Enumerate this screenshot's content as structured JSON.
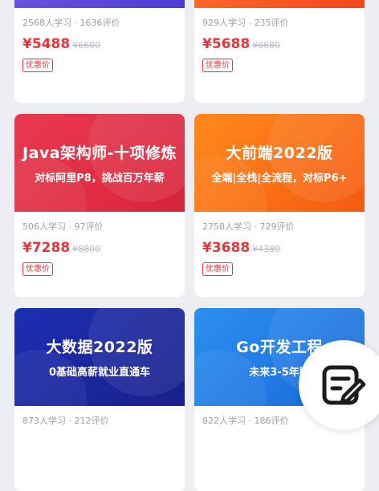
{
  "courses": [
    {
      "banner_title": "",
      "banner_subtitle": "",
      "stats": "2568人学习 · 1636评价",
      "price": "¥5488",
      "original_price": "¥6600",
      "badge": "优惠价",
      "banner_color": "#5a46d8"
    },
    {
      "banner_title": "",
      "banner_subtitle": "",
      "stats": "929人学习 · 235评价",
      "price": "¥5688",
      "original_price": "¥6680",
      "badge": "优惠价",
      "banner_color": "#f5521f"
    },
    {
      "banner_title": "Java架构师-十项修炼",
      "banner_subtitle": "对标阿里P8，挑战百万年薪",
      "stats": "506人学习 · 97评价",
      "price": "¥7288",
      "original_price": "¥8800",
      "badge": "优惠价",
      "banner_color": "#e0304a"
    },
    {
      "banner_title": "大前端2022版",
      "banner_subtitle": "全端|全栈|全流程，对标P6+",
      "stats": "2758人学习 · 729评价",
      "price": "¥3688",
      "original_price": "¥4380",
      "badge": "优惠价",
      "banner_color": "#f76a14"
    },
    {
      "banner_title": "大数据2022版",
      "banner_subtitle": "0基础高薪就业直通车",
      "stats": "873人学习 · 212评价",
      "price": "",
      "original_price": "",
      "badge": "",
      "banner_color": "#1b2aa0"
    },
    {
      "banner_title": "Go开发工程",
      "banner_subtitle": "未来3-5年刚",
      "stats": "822人学习 · 186评价",
      "price": "",
      "original_price": "",
      "badge": "",
      "banner_color": "#2279e4"
    }
  ],
  "fab": {
    "icon": "note-edit-icon"
  }
}
